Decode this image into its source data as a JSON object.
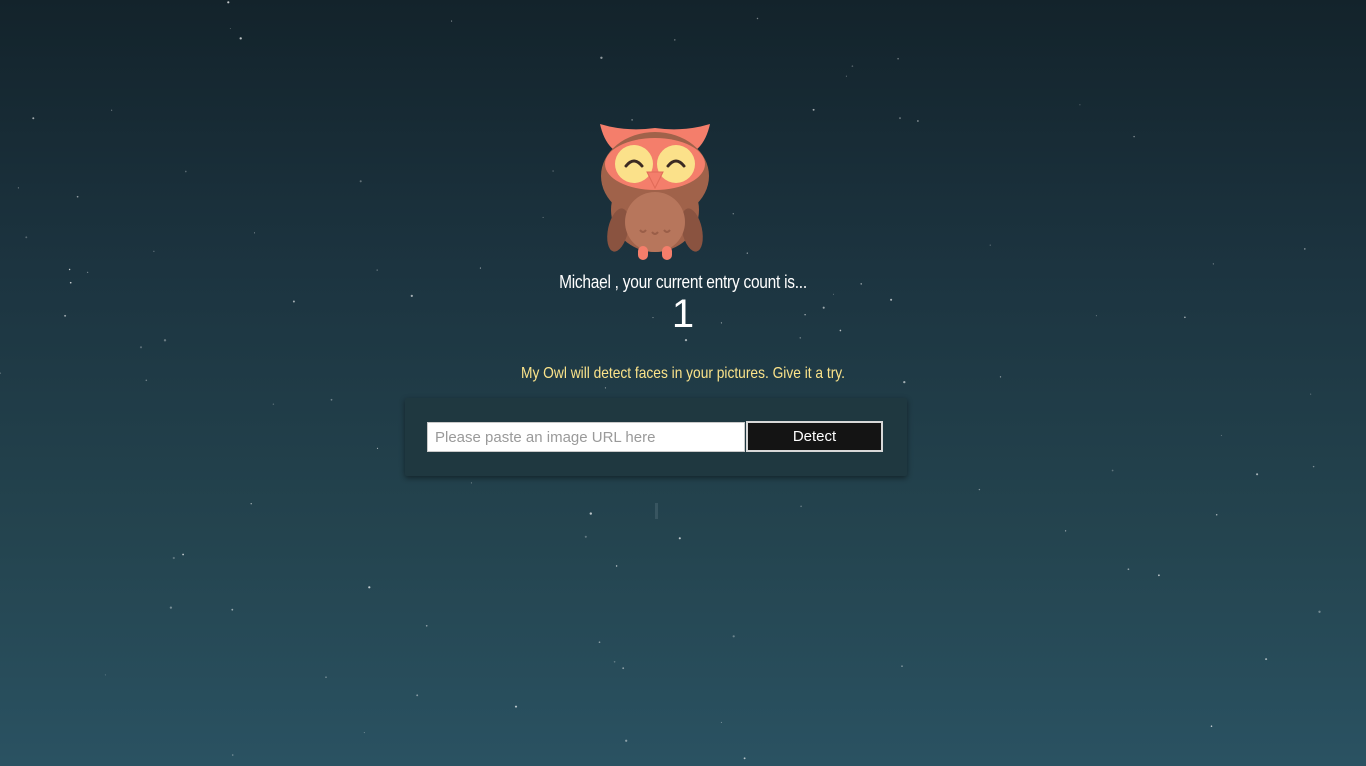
{
  "logo": {
    "name": "owl-logo",
    "colors": {
      "ears": "#f47e6b",
      "body": "#a0624a",
      "belly": "#b7765c",
      "eyes": "#fbe18a",
      "beak": "#f47e6b",
      "feet": "#f47e6b"
    }
  },
  "rank": {
    "user": "Michael",
    "message": "Michael , your current entry count is...",
    "count": "1"
  },
  "image_link_form": {
    "tagline": "My Owl will detect faces in your pictures. Give it a try.",
    "input_placeholder": "Please paste an image URL here",
    "input_value": "",
    "button_label": "Detect"
  },
  "theme": {
    "background_top": "#13232b",
    "background_bottom": "#2a5262",
    "accent_text": "#fbe38a",
    "panel": "#1f3840"
  }
}
